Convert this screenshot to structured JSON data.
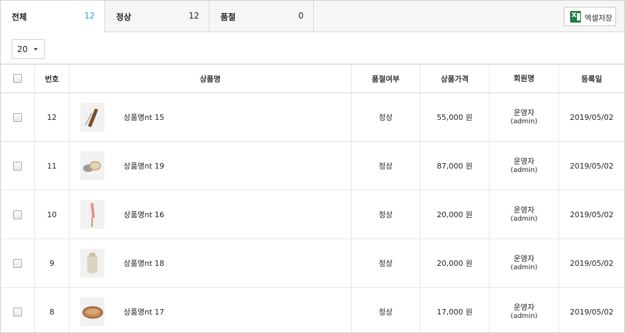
{
  "tabs": [
    {
      "label": "전체",
      "count": "12"
    },
    {
      "label": "정상",
      "count": "12"
    },
    {
      "label": "품절",
      "count": "0"
    }
  ],
  "excel_button": "엑셀저장",
  "excel_icon": "excel-icon",
  "page_size": {
    "selected": "20"
  },
  "table": {
    "headers": {
      "no": "번호",
      "name": "상품명",
      "stock": "품절여부",
      "price": "상품가격",
      "member": "회원명",
      "date": "등록일"
    },
    "rows": [
      {
        "no": "12",
        "name": "상품명nt 15",
        "stock": "정상",
        "price": "55,000 원",
        "member": "운영자",
        "member_id": "(admin)",
        "date": "2019/05/02",
        "thumb": "razor-image"
      },
      {
        "no": "11",
        "name": "상품명nt 19",
        "stock": "정상",
        "price": "87,000 원",
        "member": "운영자",
        "member_id": "(admin)",
        "date": "2019/05/02",
        "thumb": "soap-dish-image"
      },
      {
        "no": "10",
        "name": "상품명nt 16",
        "stock": "정상",
        "price": "20,000 원",
        "member": "운영자",
        "member_id": "(admin)",
        "date": "2019/05/02",
        "thumb": "brush-image"
      },
      {
        "no": "9",
        "name": "상품명nt 18",
        "stock": "정상",
        "price": "20,000 원",
        "member": "운영자",
        "member_id": "(admin)",
        "date": "2019/05/02",
        "thumb": "pouch-image"
      },
      {
        "no": "8",
        "name": "상품명nt 17",
        "stock": "정상",
        "price": "17,000 원",
        "member": "운영자",
        "member_id": "(admin)",
        "date": "2019/05/02",
        "thumb": "wooden-bowl-image"
      }
    ]
  },
  "colors": {
    "accent": "#2b9fd9",
    "excel_green": "#1f7a43"
  }
}
